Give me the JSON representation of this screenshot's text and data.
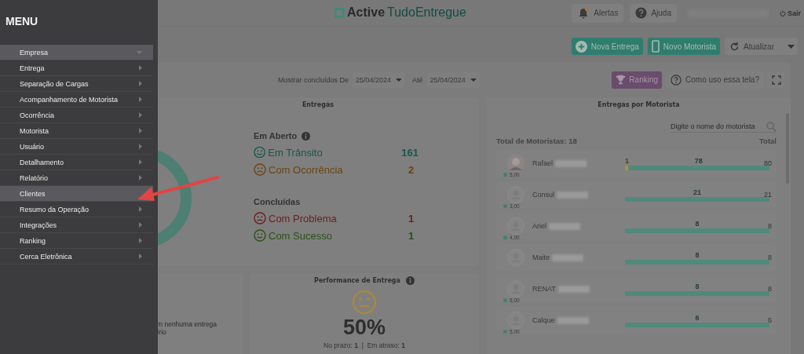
{
  "menu": {
    "title": "MENU",
    "items": [
      {
        "label": "Empresa",
        "selected": true,
        "kind": "dropdown"
      },
      {
        "label": "Entrega",
        "selected": false,
        "kind": "submenu"
      },
      {
        "label": "Separação de Cargas",
        "selected": false,
        "kind": "submenu"
      },
      {
        "label": "Acompanhamento de Motorista",
        "selected": false,
        "kind": "submenu"
      },
      {
        "label": "Ocorrência",
        "selected": false,
        "kind": "submenu"
      },
      {
        "label": "Motorista",
        "selected": false,
        "kind": "submenu"
      },
      {
        "label": "Usuário",
        "selected": false,
        "kind": "submenu"
      },
      {
        "label": "Detalhamento",
        "selected": false,
        "kind": "submenu"
      },
      {
        "label": "Relatório",
        "selected": false,
        "kind": "submenu"
      },
      {
        "label": "Clientes",
        "selected": true,
        "kind": "link"
      },
      {
        "label": "Resumo da Operação",
        "selected": false,
        "kind": "submenu"
      },
      {
        "label": "Integrações",
        "selected": false,
        "kind": "submenu"
      },
      {
        "label": "Ranking",
        "selected": false,
        "kind": "submenu"
      },
      {
        "label": "Cerca Eletrônica",
        "selected": false,
        "kind": "submenu"
      }
    ]
  },
  "header": {
    "logo_bold": "Active",
    "logo_light": "TudoEntregue",
    "alerts": "Alertas",
    "help": "Ajuda",
    "logout": "Sair"
  },
  "toolbar": {
    "new_delivery": "Nova Entrega",
    "new_driver": "Novo Motorista",
    "refresh": "Atualizar"
  },
  "filters": {
    "label": "Mostrar concluídos De",
    "from": "25/04/2024",
    "to_label": "Até",
    "to": "25/04/2024",
    "ranking": "Ranking",
    "how_to": "Como uso essa tela?"
  },
  "deliveries": {
    "title": "Entregas",
    "groups": [
      {
        "title": "Em Aberto",
        "info": true,
        "items": [
          {
            "label": "Em Trânsito",
            "count": "161",
            "color": "#15584a",
            "kind": "happy"
          },
          {
            "label": "Com Ocorrência",
            "count": "2",
            "color": "#6a4510",
            "kind": "sad"
          }
        ]
      },
      {
        "title": "Concluídas",
        "info": false,
        "items": [
          {
            "label": "Com Problema",
            "count": "1",
            "color": "#6e1c1c",
            "kind": "sad"
          },
          {
            "label": "Com Sucesso",
            "count": "1",
            "color": "#2f5016",
            "kind": "happy"
          }
        ]
      }
    ]
  },
  "notice": {
    "lines": [
      "m nenhuma entrega",
      "írio"
    ]
  },
  "performance": {
    "title": "Performance de Entrega",
    "percent": "50%",
    "summary": "No prazo: **1**  |  Em atraso: **1**"
  },
  "drivers": {
    "title": "Entregas por Motorista",
    "search_placeholder": "Digite o nome do motorista",
    "count_label": "Total de Motoristas: 18",
    "total_label": "Total",
    "rows": [
      {
        "name": "Rafael",
        "rating": "5,00",
        "photo": true,
        "total": "80",
        "segments": [
          {
            "label": "1",
            "level": 0.02,
            "color": "#b98a3c"
          },
          {
            "label": "78",
            "level": 0.98,
            "color": "#4f8a7a"
          }
        ]
      },
      {
        "name": "Consul",
        "rating": "3,00",
        "photo": false,
        "total": "21",
        "segments": [
          {
            "label": "21",
            "level": 1,
            "color": "#4f8a7a"
          }
        ]
      },
      {
        "name": "Ariel",
        "rating": "4,00",
        "photo": false,
        "total": "8",
        "segments": [
          {
            "label": "8",
            "level": 1,
            "color": "#4f8a7a"
          }
        ]
      },
      {
        "name": "Maite",
        "photo": false,
        "total": "8",
        "segments": [
          {
            "label": "8",
            "level": 1,
            "color": "#4f8a7a"
          }
        ]
      },
      {
        "name": "RENAT",
        "rating": "5,00",
        "photo": false,
        "total": "8",
        "segments": [
          {
            "label": "8",
            "level": 1,
            "color": "#4f8a7a"
          }
        ]
      },
      {
        "name": "Calque",
        "rating": "5,00",
        "photo": false,
        "total": "6",
        "segments": [
          {
            "label": "6",
            "level": 1,
            "color": "#4f8a7a"
          }
        ]
      }
    ]
  }
}
